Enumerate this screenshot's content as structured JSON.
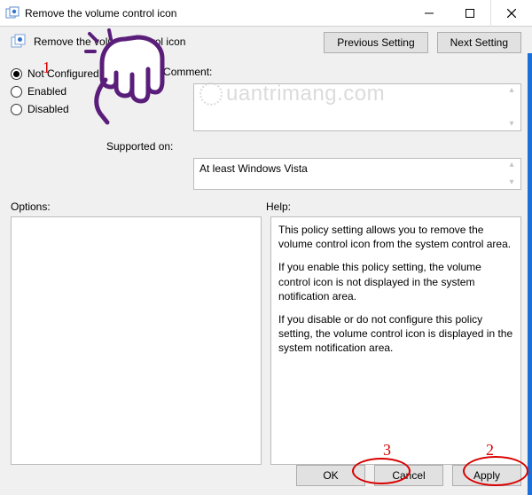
{
  "window": {
    "title": "Remove the volume control icon"
  },
  "header": {
    "policy_title": "Remove the volume control icon",
    "prev_btn": "Previous Setting",
    "next_btn": "Next Setting"
  },
  "radios": {
    "not_configured": "Not Configured",
    "enabled": "Enabled",
    "disabled": "Disabled",
    "selected": "not_configured"
  },
  "fields": {
    "comment_label": "Comment:",
    "comment_value": "",
    "supported_label": "Supported on:",
    "supported_value": "At least Windows Vista"
  },
  "sections": {
    "options_label": "Options:",
    "help_label": "Help:"
  },
  "help_text": {
    "p1": "This policy setting allows you to remove the volume control icon from the system control area.",
    "p2": "If you enable this policy setting, the volume control icon is not displayed in the system notification area.",
    "p3": "If you disable or do not configure this policy setting, the volume control icon is displayed in the system notification area."
  },
  "buttons": {
    "ok": "OK",
    "cancel": "Cancel",
    "apply": "Apply"
  },
  "annotations": {
    "n1": "1",
    "n2": "2",
    "n3": "3"
  },
  "watermark": "uantrimang.com",
  "icons": {
    "app": "policy-icon",
    "min": "minimize-icon",
    "max": "maximize-icon",
    "close": "close-icon"
  }
}
